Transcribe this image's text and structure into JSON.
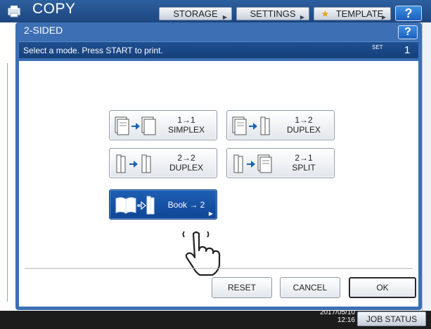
{
  "background": {
    "title": "COPY",
    "tabs": [
      "STORAGE",
      "SETTINGS",
      "TEMPLATE"
    ],
    "help_label": "?",
    "datetime": "2017/05/10\n12:16",
    "datetime_line1": "2017/05/10",
    "datetime_line2": "12:16",
    "job_status_label": "JOB STATUS"
  },
  "dialog": {
    "title": "2-SIDED",
    "help_label": "?",
    "message": "Select a mode. Press START to print.",
    "set_label": "SET",
    "set_count": "1"
  },
  "modes": [
    {
      "line1": "1→1",
      "line2": "SIMPLEX",
      "icon": "simplex-to-simplex-icon",
      "selected": false
    },
    {
      "line1": "1→2",
      "line2": "DUPLEX",
      "icon": "simplex-to-duplex-icon",
      "selected": false
    },
    {
      "line1": "2→2",
      "line2": "DUPLEX",
      "icon": "duplex-to-duplex-icon",
      "selected": false
    },
    {
      "line1": "2→1",
      "line2": "SPLIT",
      "icon": "duplex-to-simplex-icon",
      "selected": false
    },
    {
      "line1": "Book → 2",
      "line2": "",
      "icon": "book-to-duplex-icon",
      "selected": true
    }
  ],
  "actions": {
    "reset": "RESET",
    "cancel": "CANCEL",
    "ok": "OK"
  },
  "colors": {
    "accent": "#3c6fb3",
    "selected": "#1553a6",
    "message_bar": "#1a4888"
  }
}
